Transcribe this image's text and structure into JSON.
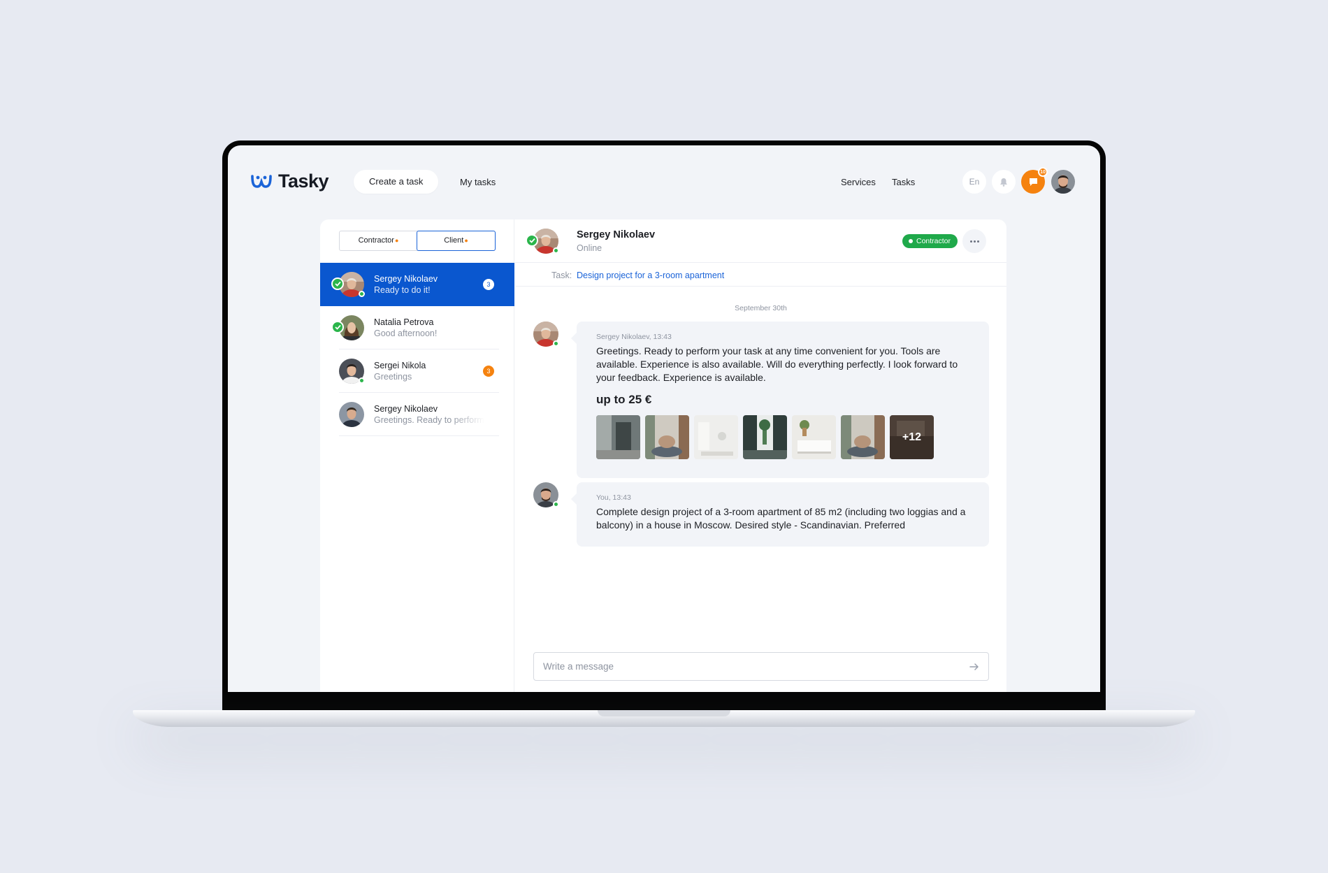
{
  "app": {
    "name": "Tasky"
  },
  "nav": {
    "create_task": "Create a task",
    "my_tasks": "My tasks",
    "services": "Services",
    "tasks": "Tasks",
    "language": "En",
    "chat_badge": "10"
  },
  "tabs": [
    {
      "label": "Contractor",
      "active": false
    },
    {
      "label": "Client",
      "active": true
    }
  ],
  "contacts": [
    {
      "name": "Sergey Nikolaev",
      "message": "Ready to do it!",
      "badge": "3",
      "selected": true,
      "verified": true,
      "online": true
    },
    {
      "name": "Natalia Petrova",
      "message": "Good afternoon!",
      "badge": "",
      "selected": false,
      "verified": true,
      "online": false
    },
    {
      "name": "Sergei Nikola",
      "message": "Greetings",
      "badge": "3",
      "selected": false,
      "verified": false,
      "online": true
    },
    {
      "name": "Sergey Nikolaev",
      "message": "Greetings. Ready to perform",
      "badge": "",
      "selected": false,
      "verified": false,
      "online": false
    }
  ],
  "chat": {
    "name": "Sergey Nikolaev",
    "status": "Online",
    "role": "Contractor",
    "task_label": "Task:",
    "task_title": "Design project for a 3-room apartment",
    "date": "September 30th",
    "messages": [
      {
        "meta": "Sergey Nikolaev, 13:43",
        "text": "Greetings. Ready to perform your task at any time convenient for you. Tools are available. Experience is also available. Will do everything perfectly. I look forward to your feedback.  Experience is available.",
        "price": "up to 25 €",
        "more_photos": "+12"
      },
      {
        "meta": "You, 13:43",
        "text": "Complete design project of a 3-room apartment of 85 m2 (including two loggias and a balcony) in a house in Moscow. Desired style - Scandinavian. Preferred"
      }
    ],
    "composer_placeholder": "Write a message"
  },
  "colors": {
    "brand_blue": "#0a57cf",
    "accent_orange": "#f5820f",
    "online_green": "#2bb54b",
    "contractor_green": "#1fa94a"
  }
}
